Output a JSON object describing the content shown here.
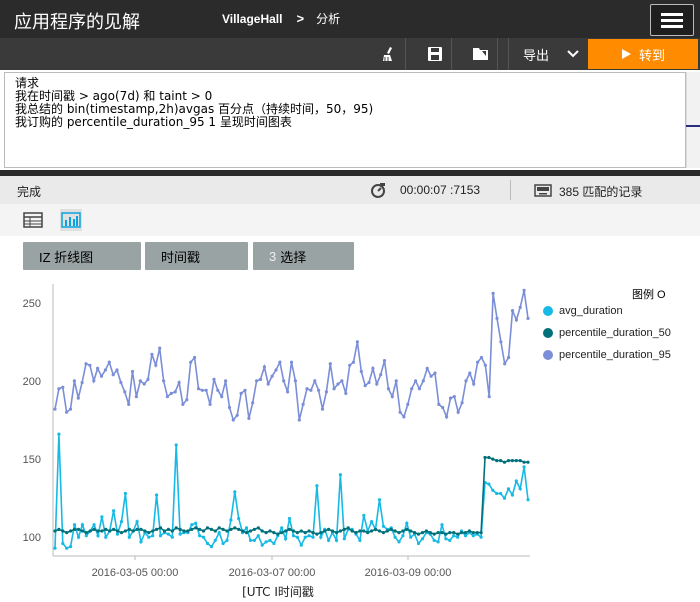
{
  "header": {
    "app_title": "应用程序的见解",
    "breadcrumb_app": "VillageHall",
    "breadcrumb_sep": ">",
    "breadcrumb_page": "分析",
    "menu_icon": "hamburger-icon"
  },
  "toolbar": {
    "icons": [
      "broom-icon",
      "save-icon",
      "open-folder-icon"
    ],
    "export_label": "导出",
    "go_label": "转到",
    "accent": "#ff8c00"
  },
  "query": {
    "lines": [
      "请求",
      "我在时间戳 > ago(7d) 和 taint > 0",
      "我总结的 bin(timestamp,2h)avgas 百分点（持续时间，50，95)",
      "我订购的 percentile_duration_95 1 呈现时间图表"
    ]
  },
  "status": {
    "state": "完成",
    "elapsed": "00:00:07 :7153",
    "records": "385 匹配的记录"
  },
  "view": {
    "icons": [
      "table-icon",
      "chart-icon"
    ]
  },
  "selectors": {
    "chart_type": "IZ 折线图",
    "x_field": "时间戳",
    "y_count": "3",
    "y_label": "选择"
  },
  "chart_data": {
    "type": "line",
    "xlabel": "[UTC I时间戳",
    "x_tick_labels": [
      "2016-03-05 00:00",
      "2016-03-07 00:00",
      "2016-03-09 00:00"
    ],
    "yticks": [
      100,
      150,
      200,
      250
    ],
    "ylim": [
      88,
      262
    ],
    "legend_title": "图例 O",
    "legend_position": "right",
    "x_start": "2016-03-03 18:00",
    "x_step_hours": 2,
    "series": [
      {
        "name": "avg_duration",
        "color": "#17b9e5",
        "values": [
          93,
          166,
          96,
          93,
          94,
          108,
          100,
          108,
          101,
          104,
          108,
          101,
          113,
          100,
          104,
          117,
          102,
          110,
          128,
          100,
          104,
          110,
          97,
          103,
          100,
          101,
          127,
          101,
          103,
          102,
          100,
          159,
          102,
          103,
          103,
          108,
          109,
          101,
          100,
          96,
          94,
          98,
          103,
          96,
          98,
          111,
          129,
          112,
          103,
          106,
          98,
          98,
          101,
          95,
          97,
          98,
          96,
          101,
          106,
          99,
          112,
          101,
          100,
          95,
          100,
          101,
          100,
          133,
          100,
          105,
          98,
          103,
          98,
          140,
          99,
          105,
          105,
          102,
          98,
          114,
          104,
          110,
          105,
          124,
          107,
          105,
          106,
          100,
          97,
          101,
          109,
          100,
          102,
          96,
          99,
          103,
          102,
          98,
          97,
          108,
          99,
          98,
          101,
          100,
          104,
          101,
          103,
          101,
          102,
          100,
          135,
          134,
          130,
          128,
          128,
          125,
          131,
          127,
          136,
          131,
          145,
          124
        ]
      },
      {
        "name": "percentile_duration_50",
        "color": "#00707a",
        "values": [
          104,
          105,
          104,
          103,
          104,
          105,
          105,
          104,
          103,
          104,
          105,
          104,
          104,
          105,
          104,
          105,
          104,
          103,
          104,
          105,
          104,
          105,
          105,
          104,
          103,
          104,
          105,
          106,
          104,
          105,
          104,
          106,
          105,
          104,
          104,
          105,
          106,
          105,
          104,
          106,
          105,
          104,
          106,
          105,
          104,
          105,
          106,
          105,
          104,
          103,
          104,
          105,
          106,
          104,
          103,
          104,
          103,
          102,
          103,
          104,
          105,
          104,
          103,
          104,
          103,
          104,
          103,
          102,
          103,
          104,
          105,
          104,
          103,
          104,
          105,
          106,
          104,
          103,
          104,
          104,
          103,
          104,
          105,
          104,
          103,
          104,
          105,
          104,
          103,
          104,
          105,
          104,
          103,
          102,
          103,
          104,
          103,
          102,
          103,
          103,
          102,
          103,
          103,
          102,
          103,
          103,
          104,
          103,
          103,
          103,
          151,
          151,
          150,
          149,
          149,
          148,
          149,
          149,
          149,
          149,
          148,
          148
        ]
      },
      {
        "name": "percentile_duration_95",
        "color": "#7b8ed8",
        "values": [
          182,
          195,
          196,
          180,
          182,
          200,
          189,
          199,
          211,
          210,
          200,
          208,
          203,
          207,
          212,
          204,
          207,
          199,
          193,
          185,
          206,
          190,
          200,
          198,
          201,
          217,
          210,
          221,
          200,
          190,
          192,
          193,
          199,
          185,
          188,
          212,
          215,
          195,
          194,
          194,
          185,
          201,
          194,
          190,
          200,
          183,
          175,
          178,
          192,
          194,
          176,
          186,
          200,
          201,
          209,
          198,
          203,
          207,
          212,
          200,
          193,
          212,
          200,
          175,
          185,
          195,
          194,
          200,
          194,
          182,
          193,
          211,
          195,
          198,
          200,
          192,
          210,
          212,
          225,
          206,
          197,
          199,
          208,
          198,
          204,
          213,
          195,
          190,
          200,
          180,
          177,
          185,
          195,
          200,
          195,
          200,
          208,
          203,
          205,
          185,
          183,
          177,
          189,
          190,
          180,
          186,
          200,
          205,
          198,
          212,
          215,
          210,
          190,
          256,
          240,
          225,
          211,
          215,
          245,
          239,
          247,
          258,
          240
        ]
      }
    ]
  }
}
